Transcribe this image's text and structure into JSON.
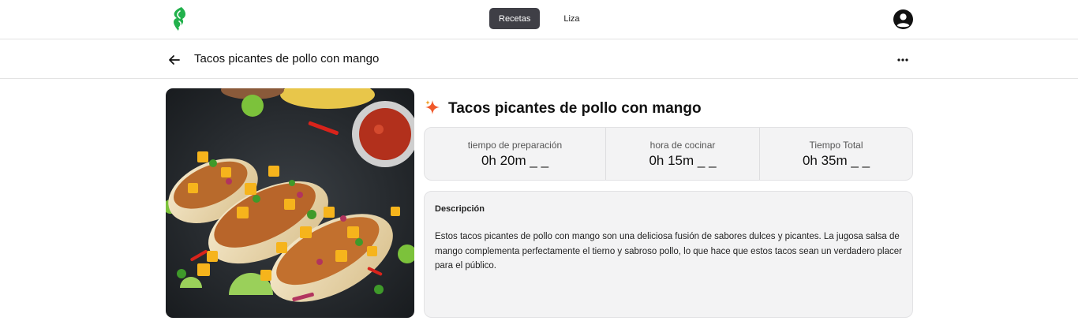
{
  "nav": {
    "tabs": [
      {
        "label": "Recetas",
        "active": true
      },
      {
        "label": "Liza",
        "active": false
      }
    ]
  },
  "header": {
    "title": "Tacos picantes de pollo con mango"
  },
  "recipe": {
    "title": "Tacos picantes de pollo con mango",
    "times": [
      {
        "label": "tiempo de preparación",
        "value": "0h 20m _ _"
      },
      {
        "label": "hora de cocinar",
        "value": "0h 15m _ _"
      },
      {
        "label": "Tiempo Total",
        "value": "0h 35m _ _"
      }
    ],
    "description_title": "Descripción",
    "description": "Estos tacos picantes de pollo con mango son una deliciosa fusión de sabores dulces y picantes. La jugosa salsa de mango complementa perfectamente el tierno y sabroso pollo, lo que hace que estos tacos sean un verdadero placer para el público."
  },
  "icons": {
    "logo": "leaf-logo-icon",
    "avatar": "user-circle-icon",
    "back": "arrow-left-icon",
    "more": "more-horizontal-icon",
    "sparkle": "sparkle-icon"
  },
  "colors": {
    "brand": "#22b14c",
    "active_tab": "#3f3f46",
    "sparkle": "#f0582a",
    "card_bg": "#f3f3f4"
  }
}
